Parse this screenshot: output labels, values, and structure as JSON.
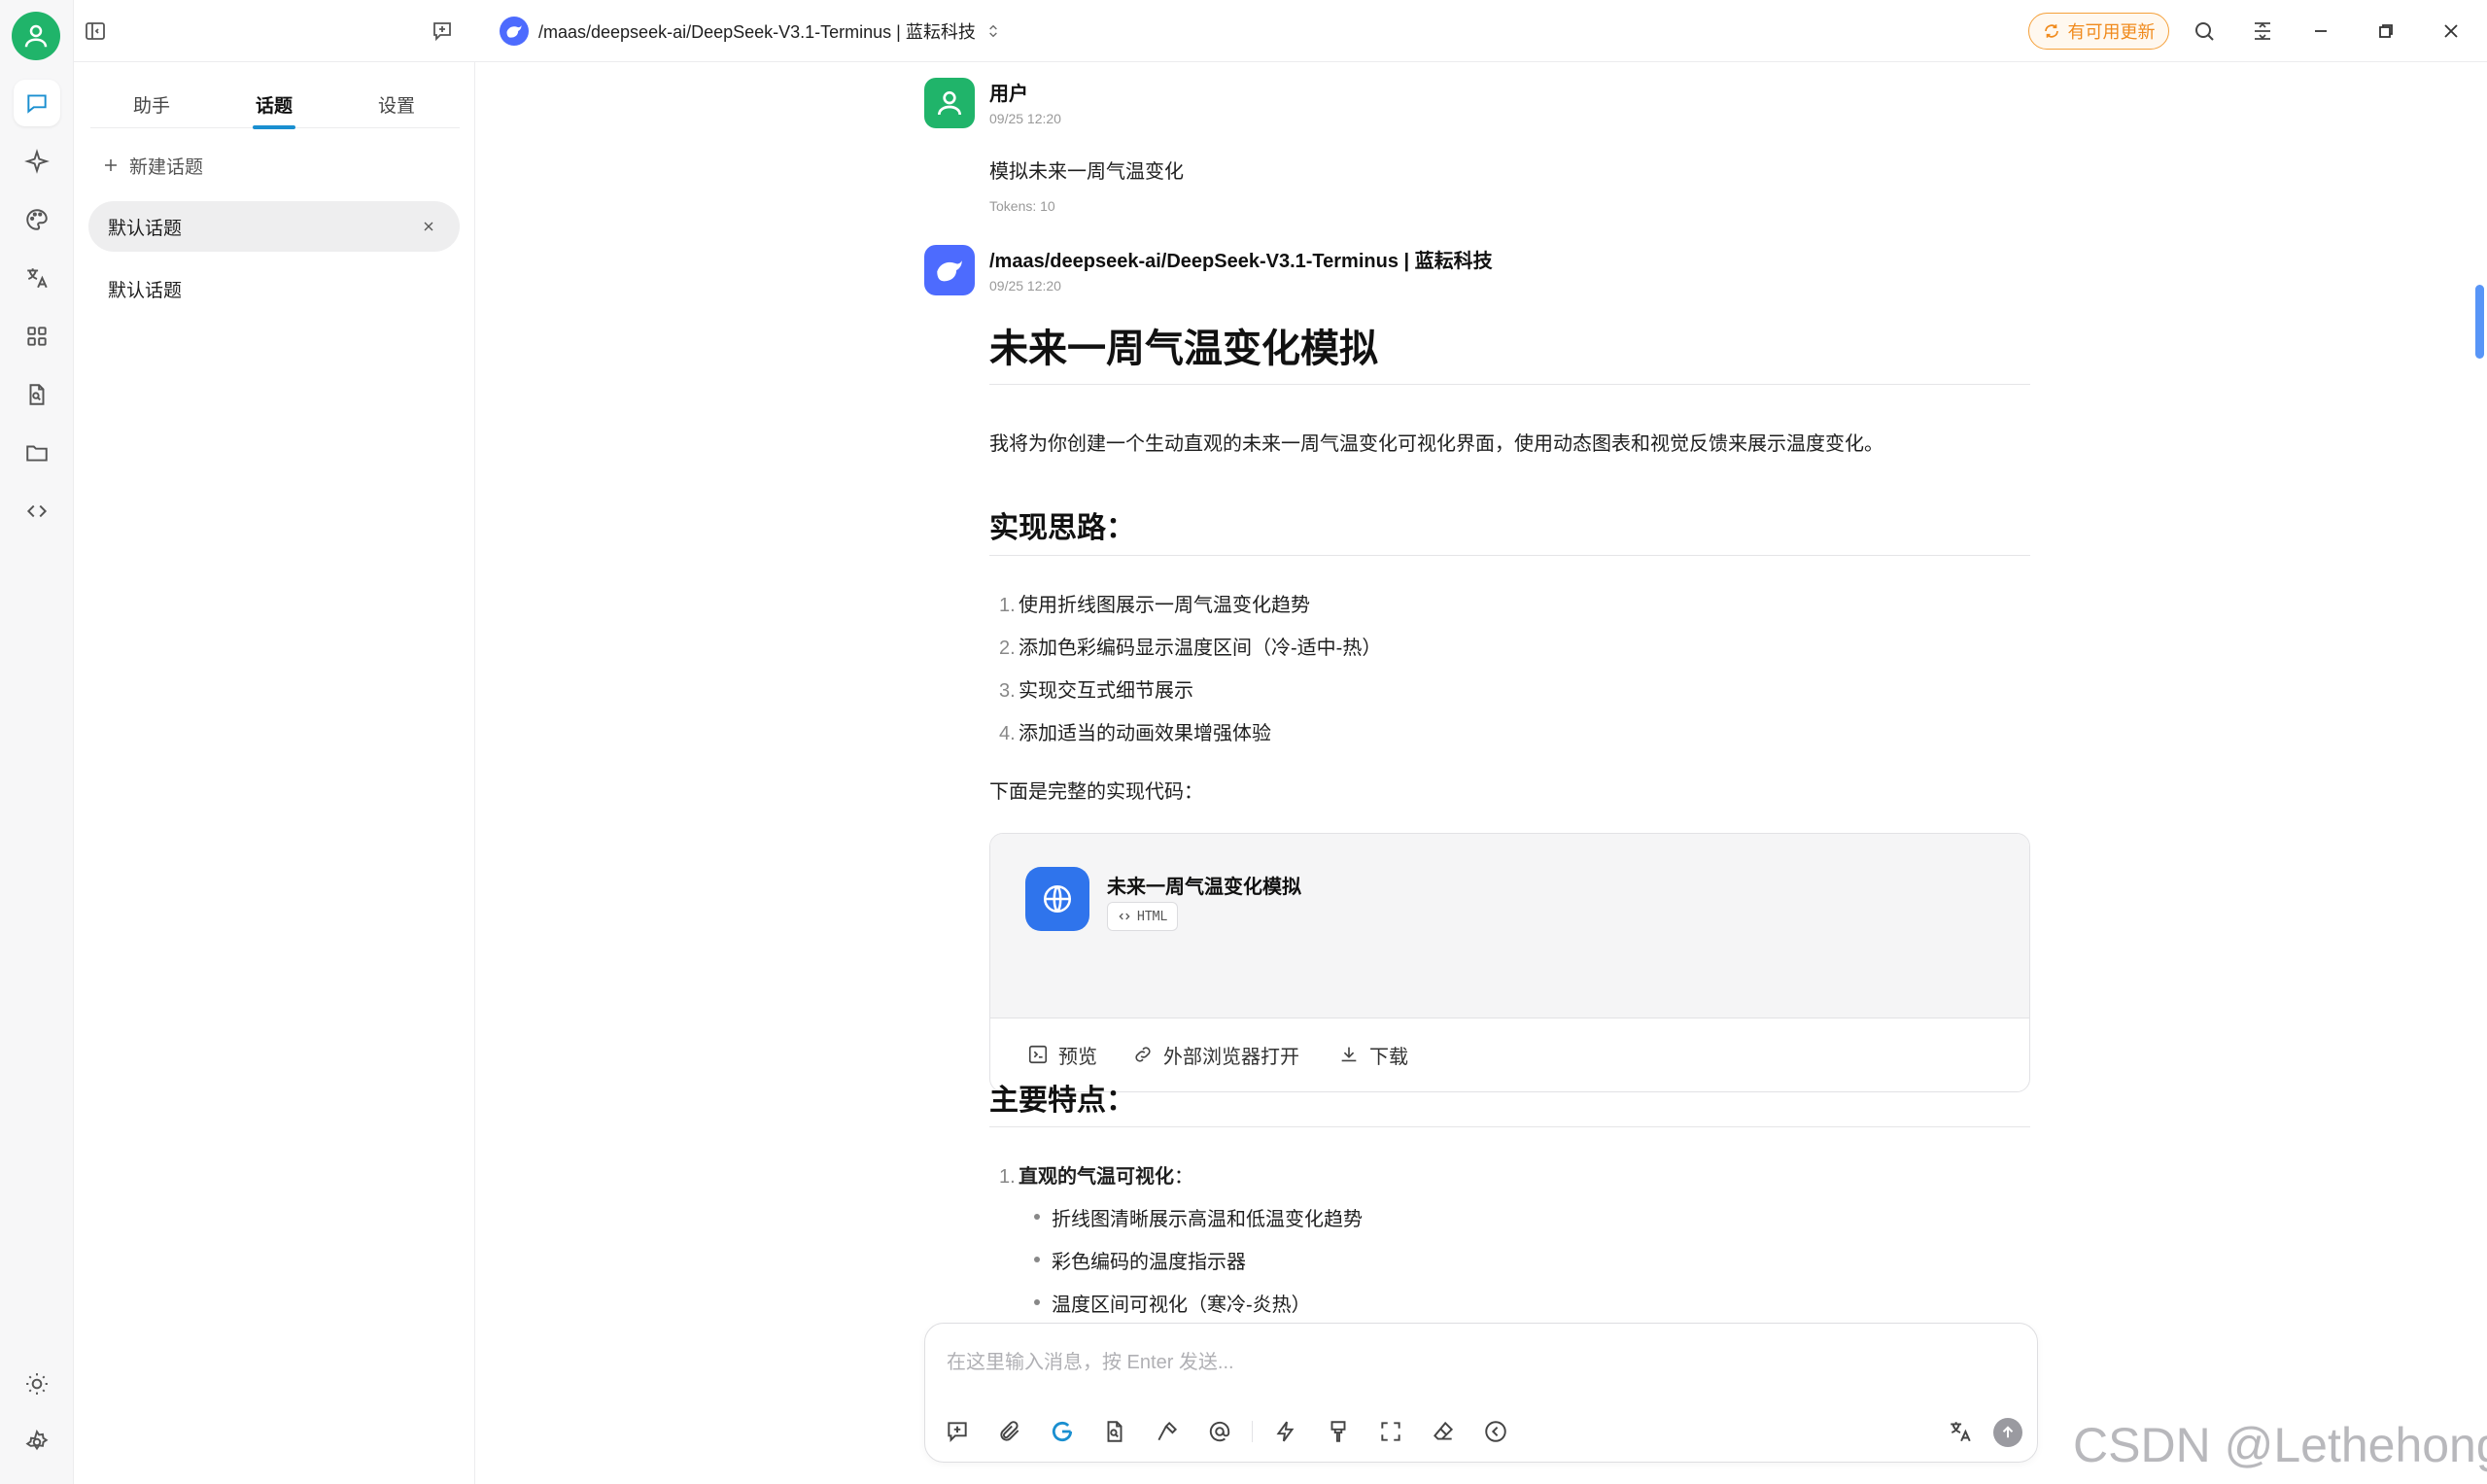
{
  "topbar": {
    "model_title": "/maas/deepseek-ai/DeepSeek-V3.1-Terminus | 蓝耘科技",
    "update_label": "有可用更新"
  },
  "panel": {
    "tabs": [
      {
        "label": "助手"
      },
      {
        "label": "话题"
      },
      {
        "label": "设置"
      }
    ],
    "new_topic_label": "新建话题",
    "topics": [
      {
        "label": "默认话题"
      },
      {
        "label": "默认话题"
      }
    ]
  },
  "chat": {
    "user_msg": {
      "name": "用户",
      "time": "09/25 12:20",
      "text": "模拟未来一周气温变化",
      "tokens": "Tokens: 10"
    },
    "bot_msg": {
      "name": "/maas/deepseek-ai/DeepSeek-V3.1-Terminus | 蓝耘科技",
      "time": "09/25 12:20",
      "h1": "未来一周气温变化模拟",
      "intro": "我将为你创建一个生动直观的未来一周气温变化可视化界面，使用动态图表和视觉反馈来展示温度变化。",
      "h2_plan": "实现思路：",
      "plan_items": [
        "使用折线图展示一周气温变化趋势",
        "添加色彩编码显示温度区间（冷-适中-热）",
        "实现交互式细节展示",
        "添加适当的动画效果增强体验"
      ],
      "code_intro": "下面是完整的实现代码：",
      "artifact": {
        "title": "未来一周气温变化模拟",
        "badge": "HTML",
        "preview": "预览",
        "open_external": "外部浏览器打开",
        "download": "下载"
      },
      "h2_features": "主要特点：",
      "feature_heading": "直观的气温可视化",
      "feature_items": [
        "折线图清晰展示高温和低温变化趋势",
        "彩色编码的温度指示器",
        "温度区间可视化（寒冷-炎热）"
      ]
    }
  },
  "composer": {
    "placeholder": "在这里输入消息，按 Enter 发送..."
  },
  "watermark": "CSDN @Lethehong",
  "colors": {
    "accent": "#1a8fd0",
    "user_avatar": "#20b46a",
    "model_logo": "#4d6bfe",
    "artifact_icon": "#2f74ec",
    "update": "#f08a1c"
  }
}
